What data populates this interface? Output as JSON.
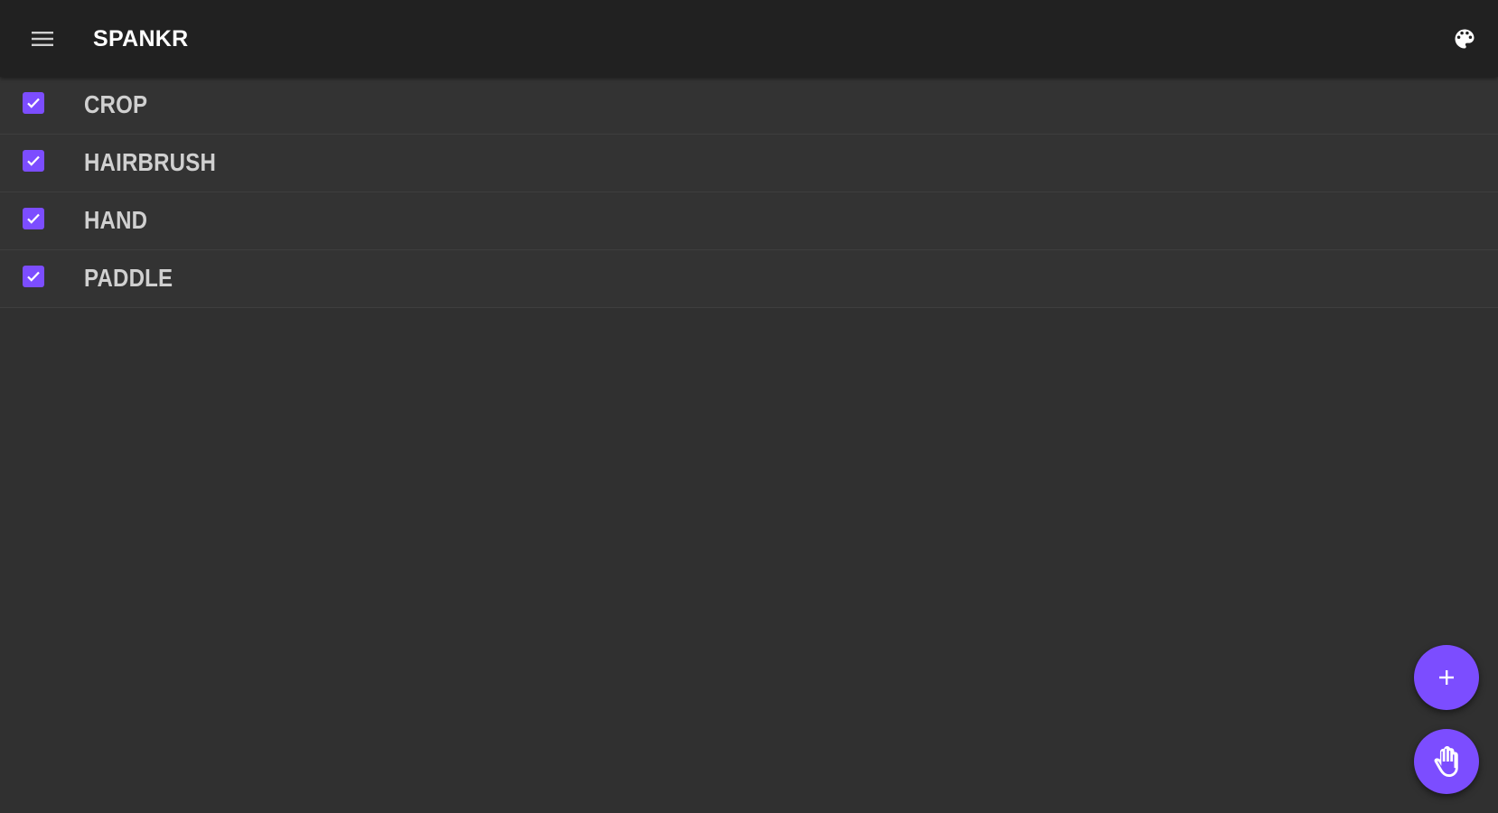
{
  "header": {
    "title": "SPANKR",
    "menu_icon": "hamburger-menu-icon",
    "theme_icon": "palette-icon"
  },
  "items": [
    {
      "label": "CROP",
      "checked": true
    },
    {
      "label": "HAIRBRUSH",
      "checked": true
    },
    {
      "label": "HAND",
      "checked": true
    },
    {
      "label": "PADDLE",
      "checked": true
    }
  ],
  "fabs": {
    "add_icon": "plus-icon",
    "hand_icon": "hand-icon"
  },
  "colors": {
    "accent": "#7c4dff",
    "toolbar": "#212121",
    "background": "#303030",
    "item_text": "#d0d0d0"
  }
}
